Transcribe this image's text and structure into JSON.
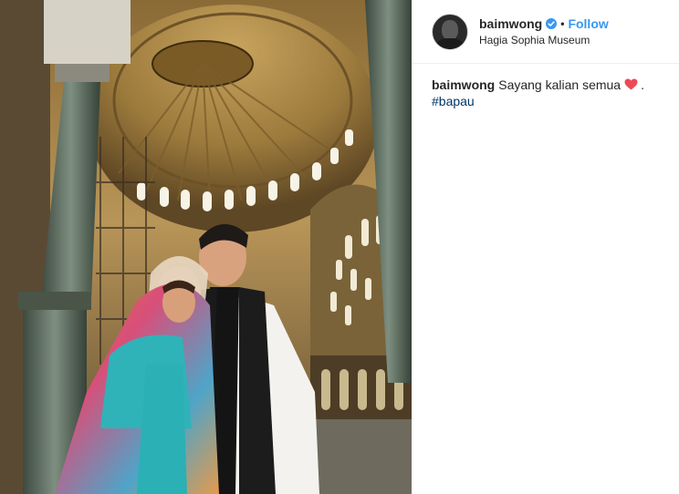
{
  "post": {
    "author": {
      "username": "baimwong",
      "verified_icon": "verified-badge-icon",
      "separator": "•",
      "follow_label": "Follow",
      "location": "Hagia Sophia Museum"
    },
    "caption": {
      "username": "baimwong",
      "text": "Sayang kalian semua",
      "emoji": "red-heart-icon",
      "trailing": ".",
      "hashtag": "#bapau"
    },
    "photo": {
      "description_icon": "post-photo"
    }
  },
  "colors": {
    "accent": "#3897f0",
    "hashtag": "#003569",
    "text": "#262626",
    "heart": "#ed4956"
  }
}
